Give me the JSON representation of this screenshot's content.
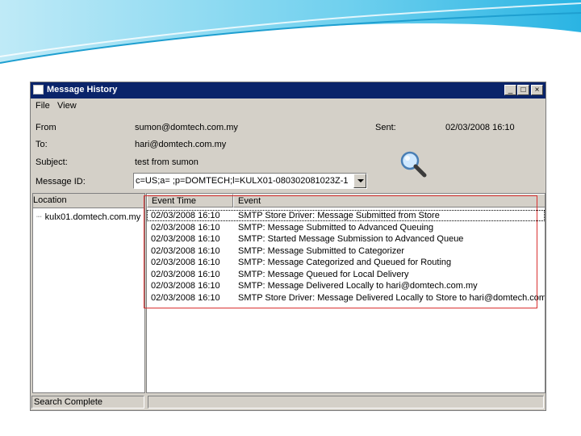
{
  "window": {
    "title": "Message History",
    "controls": [
      "_",
      "□",
      "×"
    ]
  },
  "menu": [
    "File",
    "View"
  ],
  "fields": {
    "from_label": "From",
    "from_value": "sumon@domtech.com.my",
    "sent_label": "Sent:",
    "sent_value": "02/03/2008 16:10",
    "to_label": "To:",
    "to_value": "hari@domtech.com.my",
    "subject_label": "Subject:",
    "subject_value": "test from sumon",
    "message_id_label": "Message ID:",
    "message_id_value": "c=US;a= ;p=DOMTECH;l=KULX01-080302081023Z-1"
  },
  "location_pane": {
    "header": "Location",
    "item": "kulx01.domtech.com.my"
  },
  "events": {
    "columns": [
      "Event Time",
      "Event"
    ],
    "rows": [
      [
        "02/03/2008  16:10",
        "SMTP Store Driver: Message Submitted from Store"
      ],
      [
        "02/03/2008  16:10",
        "SMTP: Message Submitted to Advanced Queuing"
      ],
      [
        "02/03/2008  16:10",
        "SMTP: Started Message Submission to Advanced Queue"
      ],
      [
        "02/03/2008  16:10",
        "SMTP: Message Submitted to Categorizer"
      ],
      [
        "02/03/2008  16:10",
        "SMTP: Message Categorized and Queued for Routing"
      ],
      [
        "02/03/2008  16:10",
        "SMTP: Message Queued for Local Delivery"
      ],
      [
        "02/03/2008  16:10",
        "SMTP: Message Delivered Locally to hari@domtech.com.my"
      ],
      [
        "02/03/2008  16:10",
        "SMTP Store Driver: Message Delivered Locally to Store to hari@domtech.com.my"
      ]
    ]
  },
  "status": "Search Complete",
  "icons": {
    "magnifier": "magnifier-icon",
    "window": "window-icon"
  },
  "colors": {
    "titlebar": "#0a246a",
    "highlight": "#d93030",
    "window_bg": "#d4d0c8"
  }
}
